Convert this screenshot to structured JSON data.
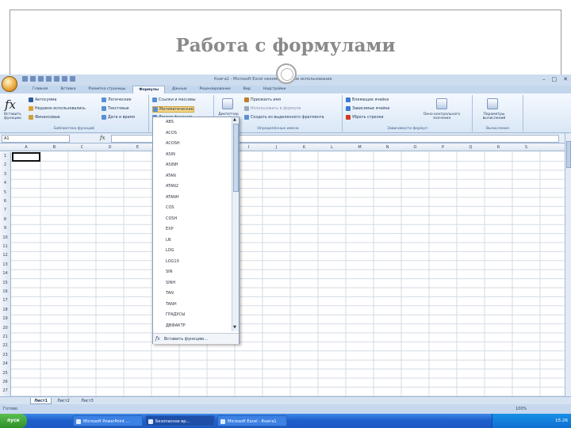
{
  "slide": {
    "title": "Работа с формулами"
  },
  "window": {
    "title": "Книга1 - Microsoft Excel некоммерческое использование"
  },
  "tabs": [
    "Главная",
    "Вставка",
    "Разметка страницы",
    "Формулы",
    "Данные",
    "Рецензирование",
    "Вид",
    "Надстройки"
  ],
  "ribbon": {
    "insert_function_label": "Вставить функцию",
    "library": {
      "autosum": "Автосумма",
      "recent": "Недавно использовались",
      "financial": "Финансовые",
      "logical": "Логические",
      "text": "Текстовые",
      "datetime": "Дата и время",
      "lookup": "Ссылки и массивы",
      "math": "Математические",
      "more": "Другие функции",
      "group_label": "Библиотека функций"
    },
    "names": {
      "manager": "Диспетчер имён",
      "assign": "Присвоить имя",
      "use": "Использовать в формуле",
      "create": "Создать из выделенного фрагмента",
      "group_label": "Определённые имена"
    },
    "audit": {
      "precedents": "Влияющие ячейки",
      "dependents": "Зависимые ячейки",
      "remove_arrows": "Убрать стрелки",
      "watch": "Окно контрольного значения",
      "group_label": "Зависимости формул"
    },
    "calc": {
      "options": "Параметры вычислений",
      "group_label": "Вычисление"
    }
  },
  "formula_bar": {
    "name_box": "A1",
    "fx": "fx"
  },
  "columns": [
    "A",
    "B",
    "C",
    "D",
    "E",
    "F",
    "G",
    "H",
    "I",
    "J",
    "K",
    "L",
    "M",
    "N",
    "O",
    "P",
    "Q",
    "R",
    "S"
  ],
  "rows": [
    "1",
    "2",
    "3",
    "4",
    "5",
    "6",
    "7",
    "8",
    "9",
    "10",
    "11",
    "12",
    "13",
    "14",
    "15",
    "16",
    "17",
    "18",
    "19",
    "20",
    "21",
    "22",
    "23",
    "24",
    "25",
    "26",
    "27"
  ],
  "dropdown": {
    "items": [
      "ABS",
      "ACOS",
      "ACOSH",
      "ASIN",
      "ASINH",
      "ATAN",
      "ATAN2",
      "ATANH",
      "COS",
      "COSH",
      "EXP",
      "LN",
      "LOG",
      "LOG10",
      "SIN",
      "SINH",
      "TAN",
      "TANH",
      "ГРАДУСЫ",
      "ДВФАКТР"
    ],
    "footer": "Вставить функцию..."
  },
  "sheets": [
    "Лист1",
    "Лист2",
    "Лист3"
  ],
  "status": {
    "ready": "Готово",
    "zoom": "100%"
  },
  "taskbar": {
    "start": "пуск",
    "tasks": [
      "Microsoft PowerPoint ...",
      "Безопасное вр...",
      "Microsoft Excel - Книга1"
    ],
    "clock": "15:26"
  }
}
